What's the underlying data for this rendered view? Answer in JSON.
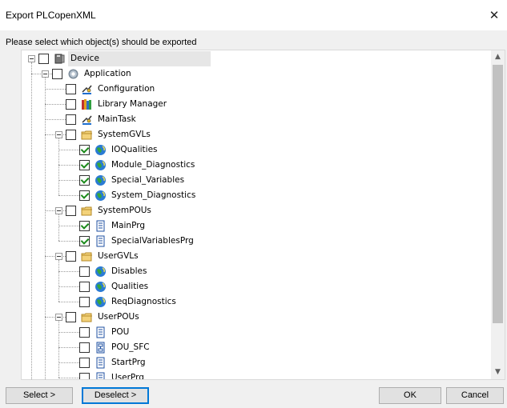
{
  "window": {
    "title": "Export PLCopenXML",
    "close_glyph": "✕"
  },
  "prompt": "Please select which object(s) should be exported",
  "tree": [
    {
      "label": "Device",
      "level": 0,
      "expander": true,
      "checked": false,
      "icon": "device-icon",
      "selected": true
    },
    {
      "label": "Application",
      "level": 1,
      "expander": true,
      "checked": false,
      "icon": "application-gear-icon"
    },
    {
      "label": "Configuration",
      "level": 2,
      "expander": false,
      "checked": false,
      "icon": "task-config-icon"
    },
    {
      "label": "Library Manager",
      "level": 2,
      "expander": false,
      "checked": false,
      "icon": "library-books-icon"
    },
    {
      "label": "MainTask",
      "level": 2,
      "expander": false,
      "checked": false,
      "icon": "task-config-icon"
    },
    {
      "label": "SystemGVLs",
      "level": 2,
      "expander": true,
      "checked": false,
      "icon": "folder-icon"
    },
    {
      "label": "IOQualities",
      "level": 3,
      "expander": false,
      "checked": true,
      "icon": "globe-gvl-icon"
    },
    {
      "label": "Module_Diagnostics",
      "level": 3,
      "expander": false,
      "checked": true,
      "icon": "globe-gvl-icon"
    },
    {
      "label": "Special_Variables",
      "level": 3,
      "expander": false,
      "checked": true,
      "icon": "globe-gvl-icon"
    },
    {
      "label": "System_Diagnostics",
      "level": 3,
      "expander": false,
      "checked": true,
      "icon": "globe-gvl-icon"
    },
    {
      "label": "SystemPOUs",
      "level": 2,
      "expander": true,
      "checked": false,
      "icon": "folder-icon"
    },
    {
      "label": "MainPrg",
      "level": 3,
      "expander": false,
      "checked": true,
      "icon": "pou-document-icon"
    },
    {
      "label": "SpecialVariablesPrg",
      "level": 3,
      "expander": false,
      "checked": true,
      "icon": "pou-document-icon"
    },
    {
      "label": "UserGVLs",
      "level": 2,
      "expander": true,
      "checked": false,
      "icon": "folder-icon"
    },
    {
      "label": "Disables",
      "level": 3,
      "expander": false,
      "checked": false,
      "icon": "globe-gvl-icon"
    },
    {
      "label": "Qualities",
      "level": 3,
      "expander": false,
      "checked": false,
      "icon": "globe-gvl-icon"
    },
    {
      "label": "ReqDiagnostics",
      "level": 3,
      "expander": false,
      "checked": false,
      "icon": "globe-gvl-icon"
    },
    {
      "label": "UserPOUs",
      "level": 2,
      "expander": true,
      "checked": false,
      "icon": "folder-icon"
    },
    {
      "label": "POU",
      "level": 3,
      "expander": false,
      "checked": false,
      "icon": "pou-document-icon"
    },
    {
      "label": "POU_SFC",
      "level": 3,
      "expander": false,
      "checked": false,
      "icon": "sfc-document-icon"
    },
    {
      "label": "StartPrg",
      "level": 3,
      "expander": false,
      "checked": false,
      "icon": "pou-document-icon"
    },
    {
      "label": "UserPrg",
      "level": 3,
      "expander": false,
      "checked": false,
      "icon": "pou-document-icon"
    }
  ],
  "scrollbar": {
    "up": "▲",
    "down": "▼",
    "up_icon": "scroll-up-icon",
    "down_icon": "scroll-down-icon"
  },
  "buttons": {
    "select": "Select >",
    "deselect": "Deselect >",
    "ok": "OK",
    "cancel": "Cancel"
  }
}
